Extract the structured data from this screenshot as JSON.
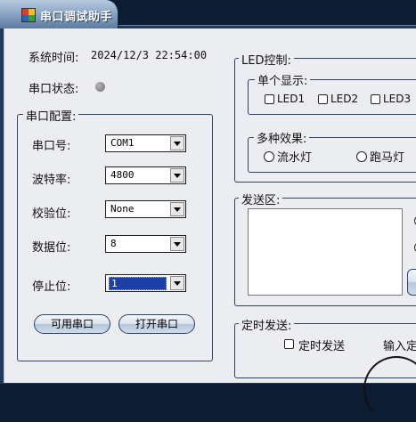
{
  "window": {
    "title": "串口调试助手"
  },
  "system_time": {
    "label": "系统时间:",
    "value": "2024/12/3 22:54:00"
  },
  "port_status": {
    "label": "串口状态:"
  },
  "port_config": {
    "title": "串口配置:",
    "port": {
      "label": "串口号:",
      "value": "COM1"
    },
    "baud": {
      "label": "波特率:",
      "value": "4800"
    },
    "parity": {
      "label": "校验位:",
      "value": "None"
    },
    "databits": {
      "label": "数据位:",
      "value": "8"
    },
    "stopbits": {
      "label": "停止位:",
      "value": "1"
    },
    "available_button": "可用串口",
    "open_button": "打开串口"
  },
  "led": {
    "title": "LED控制:",
    "single": {
      "title": "单个显示:",
      "items": [
        "LED1",
        "LED2",
        "LED3"
      ]
    },
    "effects": {
      "title": "多种效果:",
      "items": [
        "流水灯",
        "跑马灯"
      ]
    }
  },
  "send": {
    "title": "发送区:"
  },
  "timed": {
    "title": "定时发送:",
    "checkbox_label": "定时发送",
    "input_label": "输入定"
  }
}
